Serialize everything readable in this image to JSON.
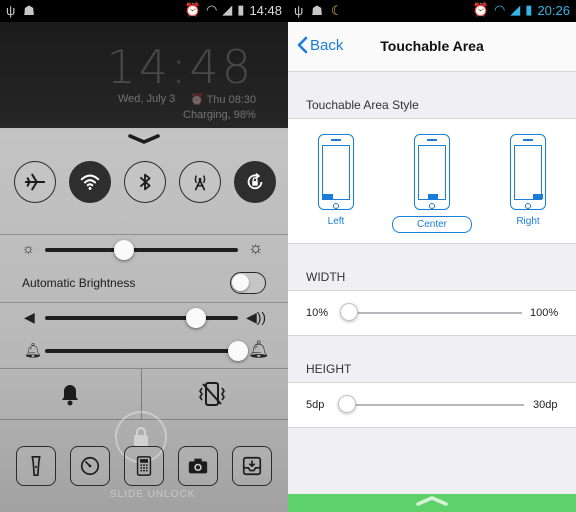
{
  "left": {
    "status_time": "14:48",
    "lock": {
      "clock": "14:48",
      "date": "Wed, July 3",
      "alarm": "Thu 08:30",
      "charging": "Charging, 98%"
    },
    "toggles": [
      {
        "name": "airplane",
        "icon": "airplane-icon",
        "on": false
      },
      {
        "name": "wifi",
        "icon": "wifi-icon",
        "on": true
      },
      {
        "name": "bluetooth",
        "icon": "bluetooth-icon",
        "on": false
      },
      {
        "name": "mobile-data",
        "icon": "antenna-icon",
        "on": false
      },
      {
        "name": "rotation-lock",
        "icon": "rotation-lock-icon",
        "on": true
      }
    ],
    "brightness_level": 0.41,
    "auto_brightness_label": "Automatic Brightness",
    "auto_brightness_on": false,
    "volume_level": 0.78,
    "ringer_level": 1.0,
    "apps": [
      "flashlight-icon",
      "timer-icon",
      "calculator-icon",
      "camera-icon",
      "inbox-icon"
    ],
    "unlock_label": "SLIDE UNLOCK"
  },
  "right": {
    "status_time": "20:26",
    "nav": {
      "back_label": "Back",
      "title": "Touchable Area"
    },
    "style_section": {
      "label": "Touchable Area Style",
      "options": [
        "Left",
        "Center",
        "Right"
      ],
      "selected": "Center"
    },
    "width": {
      "label": "WIDTH",
      "min": "10%",
      "max": "100%",
      "value_fraction": 0.0
    },
    "height": {
      "label": "HEIGHT",
      "min": "5dp",
      "max": "30dp",
      "value_fraction": 0.0
    }
  },
  "colors": {
    "accent": "#1a7dd8",
    "bottom_bar": "#5fd16b",
    "holo_blue": "#33b5e5"
  }
}
